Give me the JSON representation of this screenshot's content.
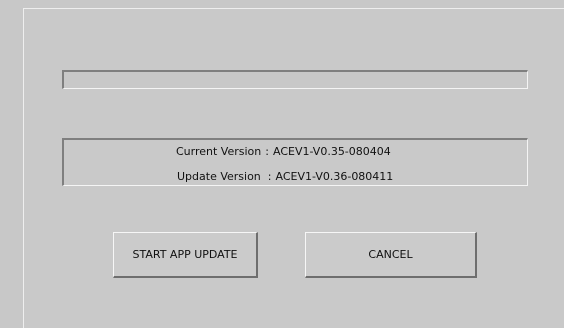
{
  "progress": {
    "fraction": 0
  },
  "versions": {
    "current_label": "Current Version",
    "current_sep": ":",
    "current_value": "ACEV1-V0.35-080404",
    "update_label": "Update Version",
    "update_sep": ":",
    "update_value": "ACEV1-V0.36-080411"
  },
  "buttons": {
    "start_label": "START APP UPDATE",
    "cancel_label": "CANCEL"
  }
}
